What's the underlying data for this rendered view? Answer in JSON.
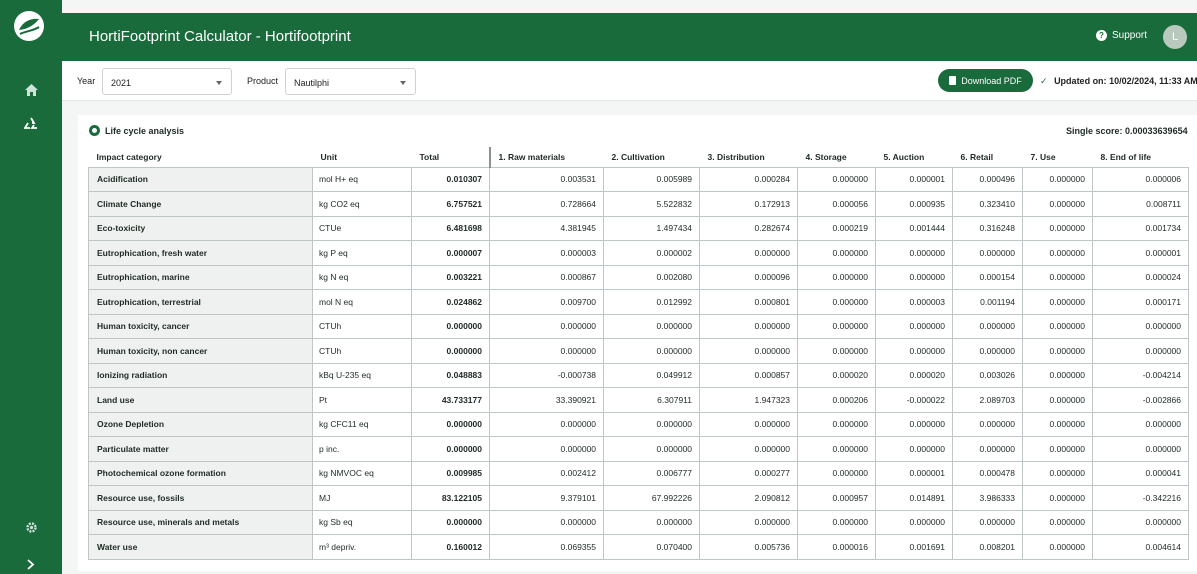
{
  "app": {
    "title": "HortiFootprint Calculator  -  Hortifootprint",
    "support_label": "Support",
    "avatar_initial": "L"
  },
  "sidebar": {
    "items": [
      {
        "name": "home",
        "icon": "home-icon"
      },
      {
        "name": "recycle",
        "icon": "recycle-icon"
      },
      {
        "name": "settings",
        "icon": "gear-icon"
      },
      {
        "name": "expand",
        "icon": "chevron-right-icon"
      }
    ]
  },
  "filters": {
    "year_label": "Year",
    "year_value": "2021",
    "product_label": "Product",
    "product_value": "Nautilphi",
    "download_label": "Download PDF",
    "updated_label": "Updated on:",
    "updated_value": "10/02/2024, 11:33 AM"
  },
  "lca": {
    "title": "Life cycle analysis",
    "single_score": "Single score:  0.00033639654",
    "columns": [
      "Impact category",
      "Unit",
      "Total",
      "1. Raw materials",
      "2. Cultivation",
      "3. Distribution",
      "4. Storage",
      "5. Auction",
      "6. Retail",
      "7. Use",
      "8. End of life"
    ],
    "rows": [
      {
        "category": "Acidification",
        "unit": "mol H+ eq",
        "total": "0.010307",
        "stages": [
          "0.003531",
          "0.005989",
          "0.000284",
          "0.000000",
          "0.000001",
          "0.000496",
          "0.000000",
          "0.000006"
        ]
      },
      {
        "category": "Climate Change",
        "unit": "kg CO2 eq",
        "total": "6.757521",
        "stages": [
          "0.728664",
          "5.522832",
          "0.172913",
          "0.000056",
          "0.000935",
          "0.323410",
          "0.000000",
          "0.008711"
        ]
      },
      {
        "category": "Eco-toxicity",
        "unit": "CTUe",
        "total": "6.481698",
        "stages": [
          "4.381945",
          "1.497434",
          "0.282674",
          "0.000219",
          "0.001444",
          "0.316248",
          "0.000000",
          "0.001734"
        ]
      },
      {
        "category": "Eutrophication, fresh water",
        "unit": "kg P eq",
        "total": "0.000007",
        "stages": [
          "0.000003",
          "0.000002",
          "0.000000",
          "0.000000",
          "0.000000",
          "0.000000",
          "0.000000",
          "0.000001"
        ]
      },
      {
        "category": "Eutrophication, marine",
        "unit": "kg N eq",
        "total": "0.003221",
        "stages": [
          "0.000867",
          "0.002080",
          "0.000096",
          "0.000000",
          "0.000000",
          "0.000154",
          "0.000000",
          "0.000024"
        ]
      },
      {
        "category": "Eutrophication, terrestrial",
        "unit": "mol N eq",
        "total": "0.024862",
        "stages": [
          "0.009700",
          "0.012992",
          "0.000801",
          "0.000000",
          "0.000003",
          "0.001194",
          "0.000000",
          "0.000171"
        ]
      },
      {
        "category": "Human toxicity, cancer",
        "unit": "CTUh",
        "total": "0.000000",
        "stages": [
          "0.000000",
          "0.000000",
          "0.000000",
          "0.000000",
          "0.000000",
          "0.000000",
          "0.000000",
          "0.000000"
        ]
      },
      {
        "category": "Human toxicity, non cancer",
        "unit": "CTUh",
        "total": "0.000000",
        "stages": [
          "0.000000",
          "0.000000",
          "0.000000",
          "0.000000",
          "0.000000",
          "0.000000",
          "0.000000",
          "0.000000"
        ]
      },
      {
        "category": "Ionizing radiation",
        "unit": "kBq U-235 eq",
        "total": "0.048883",
        "stages": [
          "-0.000738",
          "0.049912",
          "0.000857",
          "0.000020",
          "0.000020",
          "0.003026",
          "0.000000",
          "-0.004214"
        ]
      },
      {
        "category": "Land use",
        "unit": "Pt",
        "total": "43.733177",
        "stages": [
          "33.390921",
          "6.307911",
          "1.947323",
          "0.000206",
          "-0.000022",
          "2.089703",
          "0.000000",
          "-0.002866"
        ]
      },
      {
        "category": "Ozone Depletion",
        "unit": "kg CFC11 eq",
        "total": "0.000000",
        "stages": [
          "0.000000",
          "0.000000",
          "0.000000",
          "0.000000",
          "0.000000",
          "0.000000",
          "0.000000",
          "0.000000"
        ]
      },
      {
        "category": "Particulate matter",
        "unit": "p inc.",
        "total": "0.000000",
        "stages": [
          "0.000000",
          "0.000000",
          "0.000000",
          "0.000000",
          "0.000000",
          "0.000000",
          "0.000000",
          "0.000000"
        ]
      },
      {
        "category": "Photochemical ozone formation",
        "unit": "kg NMVOC eq",
        "total": "0.009985",
        "stages": [
          "0.002412",
          "0.006777",
          "0.000277",
          "0.000000",
          "0.000001",
          "0.000478",
          "0.000000",
          "0.000041"
        ]
      },
      {
        "category": "Resource use, fossils",
        "unit": "MJ",
        "total": "83.122105",
        "stages": [
          "9.379101",
          "67.992226",
          "2.090812",
          "0.000957",
          "0.014891",
          "3.986333",
          "0.000000",
          "-0.342216"
        ]
      },
      {
        "category": "Resource use, minerals and metals",
        "unit": "kg Sb eq",
        "total": "0.000000",
        "stages": [
          "0.000000",
          "0.000000",
          "0.000000",
          "0.000000",
          "0.000000",
          "0.000000",
          "0.000000",
          "0.000000"
        ]
      },
      {
        "category": "Water use",
        "unit": "m³ depriv.",
        "total": "0.160012",
        "stages": [
          "0.069355",
          "0.070400",
          "0.005736",
          "0.000016",
          "0.001691",
          "0.008201",
          "0.000000",
          "0.004614"
        ]
      }
    ]
  },
  "colors": {
    "brand_green": "#1a6b3c",
    "background": "#f4f5f5"
  }
}
